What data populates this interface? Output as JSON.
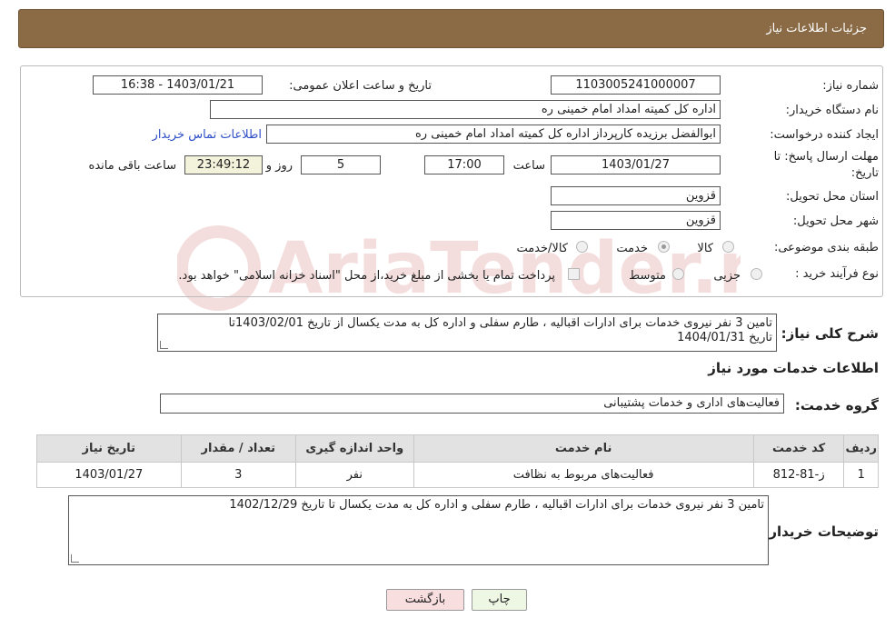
{
  "header": {
    "title": "جزئیات اطلاعات نیاز"
  },
  "need_number": {
    "label": "شماره نیاز:",
    "value": "1103005241000007"
  },
  "announce_datetime": {
    "label": "تاریخ و ساعت اعلان عمومی:",
    "value": "1403/01/21 - 16:38"
  },
  "buyer_org": {
    "label": "نام دستگاه خریدار:",
    "value": "اداره کل کمیته امداد امام خمینی  ره"
  },
  "requester": {
    "label": "ایجاد کننده درخواست:",
    "value": "ابوالفضل برزیده کارپرداز اداره کل کمیته امداد امام خمینی  ره",
    "contact_link": "اطلاعات تماس خریدار"
  },
  "deadline": {
    "label_line1": "مهلت ارسال پاسخ: تا",
    "label_line2": "تاریخ:",
    "date": "1403/01/27",
    "time_label": "ساعت",
    "time": "17:00",
    "days": "5",
    "days_label": "روز و",
    "remaining": "23:49:12",
    "remaining_label": "ساعت باقی مانده"
  },
  "province": {
    "label": "استان محل تحویل:",
    "value": "قزوین"
  },
  "city": {
    "label": "شهر محل تحویل:",
    "value": "قزوین"
  },
  "category": {
    "label": "طبقه بندی موضوعی:",
    "options": [
      "کالا",
      "خدمت",
      "کالا/خدمت"
    ],
    "selected": "خدمت"
  },
  "purchase_type": {
    "label": "نوع فرآیند خرید :",
    "options": [
      "جزیی",
      "متوسط"
    ],
    "note": "پرداخت تمام یا بخشی از مبلغ خرید،از محل \"اسناد خزانه اسلامی\" خواهد بود."
  },
  "summary": {
    "label": "شرح کلی نیاز:",
    "line1": "تامین 3 نفر نیروی خدمات برای ادارات اقبالیه ، طارم سفلی و اداره کل به مدت یکسال از تاریخ 1403/02/01تا",
    "line2": "تاریخ 1404/01/31"
  },
  "services_section": {
    "title": "اطلاعات خدمات مورد نیاز"
  },
  "service_group": {
    "label": "گروه خدمت:",
    "value": "فعالیت‌های اداری و خدمات پشتیبانی"
  },
  "table": {
    "columns": [
      "ردیف",
      "کد خدمت",
      "نام خدمت",
      "واحد اندازه گیری",
      "تعداد / مقدار",
      "تاریخ نیاز"
    ],
    "rows": [
      {
        "index": "1",
        "code": "ز-81-812",
        "name": "فعالیت‌های مربوط به نظافت",
        "unit": "نفر",
        "qty": "3",
        "date": "1403/01/27"
      }
    ]
  },
  "buyer_notes": {
    "label": "توضیحات خریدار:",
    "value": "تامین 3 نفر نیروی خدمات برای ادارات اقبالیه ، طارم سفلی و اداره کل به مدت یکسال تا تاریخ 1402/12/29"
  },
  "buttons": {
    "print": "چاپ",
    "back": "بازگشت"
  },
  "colors": {
    "header_bg": "#8b6b45",
    "link": "#2e4fc7",
    "back_button": "#f8dede",
    "print_button": "#eef7e4"
  }
}
